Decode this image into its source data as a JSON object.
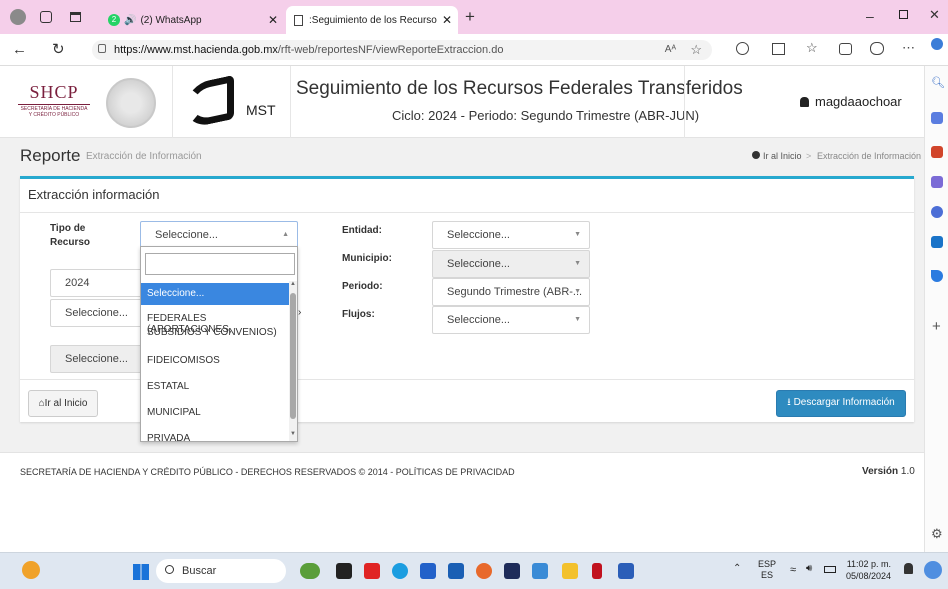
{
  "browser": {
    "tabs": [
      {
        "label": "(2) WhatsApp",
        "badge": "2"
      },
      {
        "label": ":Seguimiento de los Recursos Fe"
      }
    ],
    "url_prefix": "https://www.mst.hacienda.gob.mx",
    "url_rest": "/rft-web/reportesNF/viewReporteExtraccion.do",
    "reader_icon": "Aᴬ",
    "colors": {
      "tabbar": "#f5cfea"
    }
  },
  "header": {
    "logo_shcp": "SHCP",
    "logo_sub1": "SECRETARÍA DE HACIENDA",
    "logo_sub2": "Y CRÉDITO PÚBLICO",
    "logo_mst": "MST",
    "title": "Seguimiento de los Recursos Federales Transferidos",
    "subtitle": "Ciclo: 2024 - Periodo: Segundo Trimestre (ABR-JUN)",
    "user": "magdaaochoar"
  },
  "breadcrumb": {
    "page_title": "Reporte",
    "page_subtitle": "Extracción de Información",
    "home": "Ir al Inicio",
    "separator": ">",
    "current": "Extracción de Información"
  },
  "panel": {
    "title": "Extracción información",
    "tipo_label_1": "Tipo de",
    "tipo_label_2": "Recurso",
    "tipo_value": "Seleccione...",
    "year_value": "2024",
    "sel_a": "Seleccione...",
    "sel_b": "Seleccione...",
    "entidad_label": "Entidad:",
    "entidad_value": "Seleccione...",
    "municipio_label": "Municipio:",
    "municipio_value": "Seleccione...",
    "periodo_label": "Periodo:",
    "periodo_value": "Segundo Trimestre (ABR-...",
    "flujos_label": "Flujos:",
    "flujos_value": "Seleccione...",
    "home_button": "Ir al Inicio",
    "download_button": "Descargar Información",
    "accent": "#27a9cf",
    "download_color": "#2e8bc0"
  },
  "dropdown": {
    "search_placeholder": "",
    "options": [
      "Seleccione...",
      "FEDERALES (APORTACIONES,",
      "SUBSIDIOS Y CONVENIOS)",
      "FIDEICOMISOS",
      "ESTATAL",
      "MUNICIPAL",
      "PRIVADA"
    ],
    "selected_color": "#3a87e0"
  },
  "footer": {
    "text": "SECRETARÍA DE HACIENDA Y CRÉDITO PÚBLICO - DERECHOS RESERVADOS © 2014 - POLÍTICAS DE PRIVACIDAD",
    "version_label": "Versión",
    "version": "1.0"
  },
  "taskbar": {
    "search": "Buscar",
    "lang1": "ESP",
    "lang2": "ES",
    "time": "11:02 p. m.",
    "date": "05/08/2024"
  }
}
